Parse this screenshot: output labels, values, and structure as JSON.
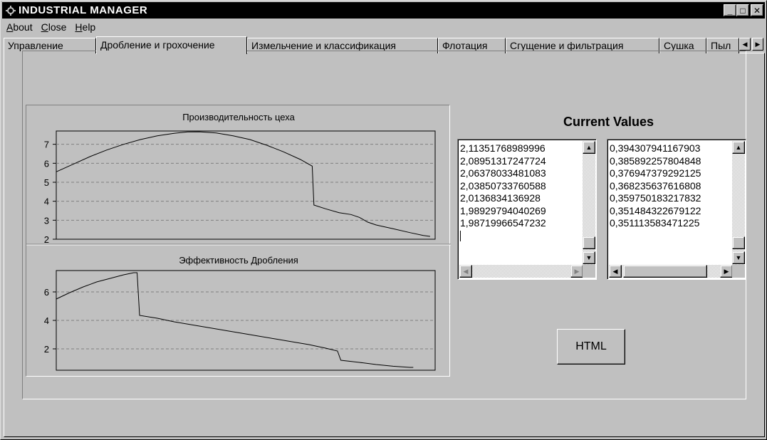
{
  "window": {
    "title": "INDUSTRIAL MANAGER",
    "minimize_label": "_",
    "maximize_label": "□",
    "close_label": "✕"
  },
  "menu": [
    {
      "label": "About",
      "mnemonic": "A"
    },
    {
      "label": "Close",
      "mnemonic": "C"
    },
    {
      "label": "Help",
      "mnemonic": "H"
    }
  ],
  "tabs": [
    {
      "label": "Управление",
      "active": false
    },
    {
      "label": "Дробление и грохочение",
      "active": true
    },
    {
      "label": "Измельчение и классификация",
      "active": false
    },
    {
      "label": "Флотация",
      "active": false
    },
    {
      "label": "Сгущение и фильтрация",
      "active": false
    },
    {
      "label": "Сушка",
      "active": false
    },
    {
      "label": "Пыл",
      "active": false
    }
  ],
  "current_values": {
    "title": "Current Values",
    "list1": [
      "2,11351768989996",
      "2,08951317247724",
      "2,06378033481083",
      "2,03850733760588",
      "2,0136834136928",
      "1,98929794040269",
      "1,98719966547232"
    ],
    "list2": [
      "0,394307941167903",
      "0,385892257804848",
      "0,376947379292125",
      "0,368235637616808",
      "0,359750183217832",
      "0,351484322679122",
      "0,351113583471225"
    ]
  },
  "html_button": "HTML",
  "chart_data": [
    {
      "type": "line",
      "title": "Производительность цеха",
      "xlabel": "",
      "ylabel": "",
      "ylim": [
        2,
        7.7
      ],
      "yticks": [
        "2",
        "3",
        "4",
        "5",
        "6",
        "7"
      ],
      "grid": true,
      "points": [
        [
          0,
          5.55
        ],
        [
          10,
          5.95
        ],
        [
          20,
          6.35
        ],
        [
          30,
          6.7
        ],
        [
          40,
          7.0
        ],
        [
          50,
          7.25
        ],
        [
          60,
          7.45
        ],
        [
          70,
          7.58
        ],
        [
          78,
          7.65
        ],
        [
          85,
          7.66
        ],
        [
          95,
          7.6
        ],
        [
          105,
          7.45
        ],
        [
          115,
          7.25
        ],
        [
          125,
          6.95
        ],
        [
          135,
          6.6
        ],
        [
          145,
          6.2
        ],
        [
          150,
          5.95
        ],
        [
          152,
          5.85
        ],
        [
          153,
          3.8
        ],
        [
          160,
          3.6
        ],
        [
          168,
          3.4
        ],
        [
          175,
          3.3
        ],
        [
          180,
          3.15
        ],
        [
          185,
          2.9
        ],
        [
          190,
          2.75
        ],
        [
          200,
          2.55
        ],
        [
          210,
          2.35
        ],
        [
          218,
          2.2
        ],
        [
          222,
          2.15
        ]
      ],
      "xlim": [
        0,
        225
      ]
    },
    {
      "type": "line",
      "title": "Эффективность Дробления",
      "xlabel": "",
      "ylabel": "",
      "ylim": [
        0.5,
        7.5
      ],
      "yticks": [
        "2",
        "4",
        "6"
      ],
      "grid": true,
      "points": [
        [
          0,
          5.5
        ],
        [
          8,
          5.95
        ],
        [
          16,
          6.35
        ],
        [
          24,
          6.7
        ],
        [
          32,
          6.95
        ],
        [
          40,
          7.2
        ],
        [
          46,
          7.35
        ],
        [
          48,
          7.35
        ],
        [
          49.5,
          4.35
        ],
        [
          60,
          4.15
        ],
        [
          70,
          3.9
        ],
        [
          80,
          3.7
        ],
        [
          90,
          3.5
        ],
        [
          100,
          3.3
        ],
        [
          110,
          3.1
        ],
        [
          120,
          2.9
        ],
        [
          130,
          2.7
        ],
        [
          140,
          2.5
        ],
        [
          150,
          2.3
        ],
        [
          160,
          2.05
        ],
        [
          167,
          1.85
        ],
        [
          169,
          1.2
        ],
        [
          180,
          1.05
        ],
        [
          190,
          0.9
        ],
        [
          200,
          0.78
        ],
        [
          210,
          0.7
        ],
        [
          212,
          0.7
        ]
      ],
      "xlim": [
        0,
        225
      ]
    }
  ]
}
